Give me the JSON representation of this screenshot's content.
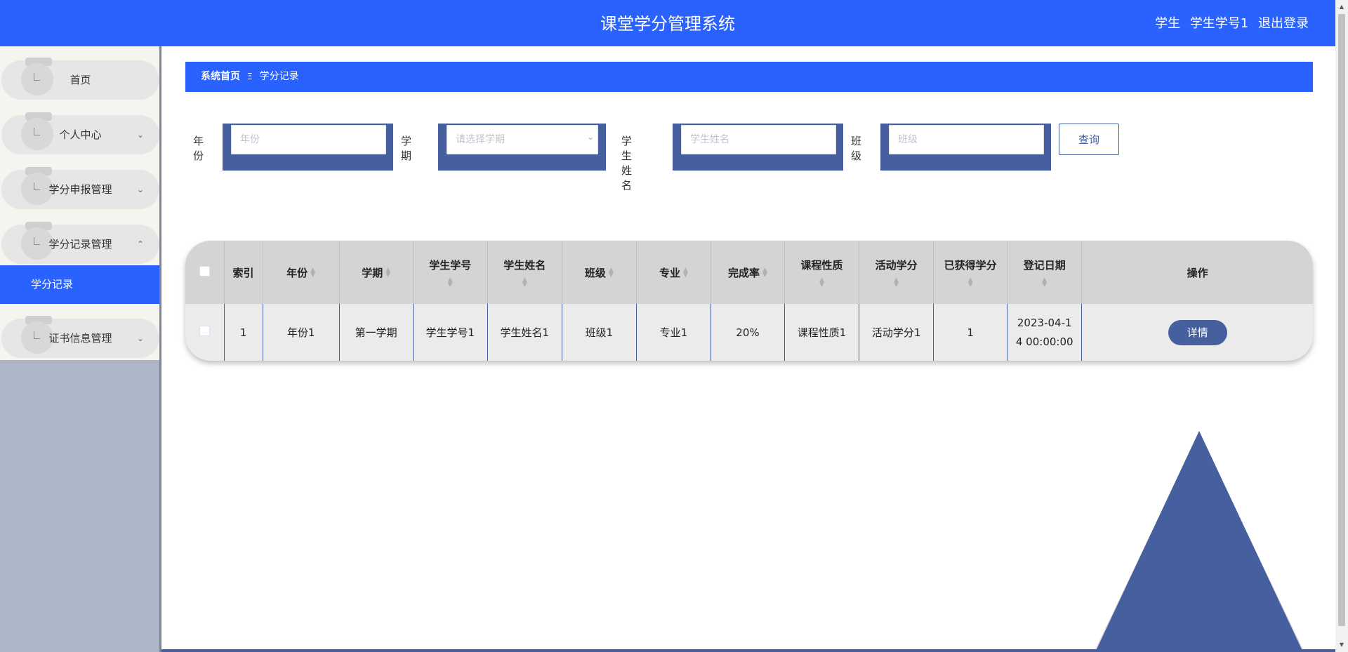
{
  "header": {
    "title": "课堂学分管理系统",
    "role": "学生",
    "username": "学生学号1",
    "logout": "退出登录"
  },
  "sidebar": {
    "items": [
      {
        "label": "首页",
        "icon": "home-icon"
      },
      {
        "label": "个人中心",
        "expand": "chevron-down-icon"
      },
      {
        "label": "学分申报管理",
        "expand": "chevron-down-icon"
      },
      {
        "label": "学分记录管理",
        "expand": "chevron-up-icon"
      },
      {
        "label": "证书信息管理",
        "expand": "chevron-down-icon"
      }
    ],
    "sub_item": "学分记录"
  },
  "breadcrumb": {
    "home": "系统首页",
    "separator": "Ξ",
    "current": "学分记录"
  },
  "search": {
    "year_label": "年份",
    "year_placeholder": "年份",
    "term_label": "学期",
    "term_placeholder": "请选择学期",
    "name_label": "学生姓名",
    "name_placeholder": "学生姓名",
    "class_label": "班级",
    "class_placeholder": "班级",
    "query_button": "查询"
  },
  "table": {
    "columns": [
      "索引",
      "年份",
      "学期",
      "学生学号",
      "学生姓名",
      "班级",
      "专业",
      "完成率",
      "课程性质",
      "活动学分",
      "已获得学分",
      "登记日期",
      "操作"
    ],
    "rows": [
      {
        "index": "1",
        "year": "年份1",
        "term": "第一学期",
        "student_no": "学生学号1",
        "student_name": "学生姓名1",
        "class": "班级1",
        "major": "专业1",
        "completion": "20%",
        "course_type": "课程性质1",
        "activity_credit": "活动学分1",
        "earned_credit": "1",
        "date_line1": "2023-04-1",
        "date_line2": "4 00:00:00",
        "action": "详情"
      }
    ]
  },
  "colors": {
    "primary": "#2962ff",
    "accent": "#46609f",
    "sidebar_bg": "#adb6c9"
  }
}
